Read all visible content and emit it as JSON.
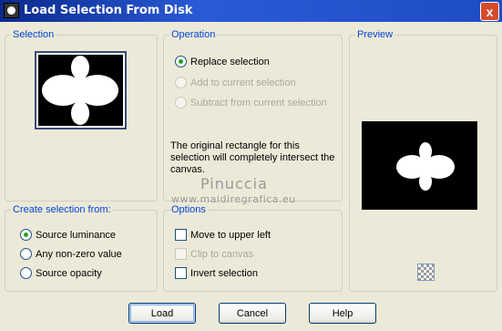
{
  "window": {
    "title": "Load Selection From Disk",
    "close_label": "x"
  },
  "selection": {
    "title": "Selection"
  },
  "operation": {
    "title": "Operation",
    "options": [
      {
        "label": "Replace selection",
        "checked": true,
        "enabled": true
      },
      {
        "label": "Add to current selection",
        "checked": false,
        "enabled": false
      },
      {
        "label": "Subtract from current selection",
        "checked": false,
        "enabled": false
      }
    ],
    "info": "The original rectangle for this selection will completely intersect the canvas."
  },
  "preview": {
    "title": "Preview"
  },
  "create_from": {
    "title": "Create selection from:",
    "options": [
      {
        "label": "Source luminance",
        "checked": true
      },
      {
        "label": "Any non-zero value",
        "checked": false
      },
      {
        "label": "Source opacity",
        "checked": false
      }
    ]
  },
  "options": {
    "title": "Options",
    "items": [
      {
        "label": "Move to upper left",
        "checked": false,
        "enabled": true
      },
      {
        "label": "Clip to canvas",
        "checked": false,
        "enabled": false
      },
      {
        "label": "Invert selection",
        "checked": false,
        "enabled": true
      }
    ]
  },
  "watermark": {
    "name": "Pinuccia",
    "url": "www.maidiregrafica.eu"
  },
  "buttons": {
    "load": "Load",
    "cancel": "Cancel",
    "help": "Help"
  },
  "colors": {
    "titlebar": "#1d4cc4",
    "group_title": "#0046d5",
    "radio_dot": "#21a121"
  }
}
